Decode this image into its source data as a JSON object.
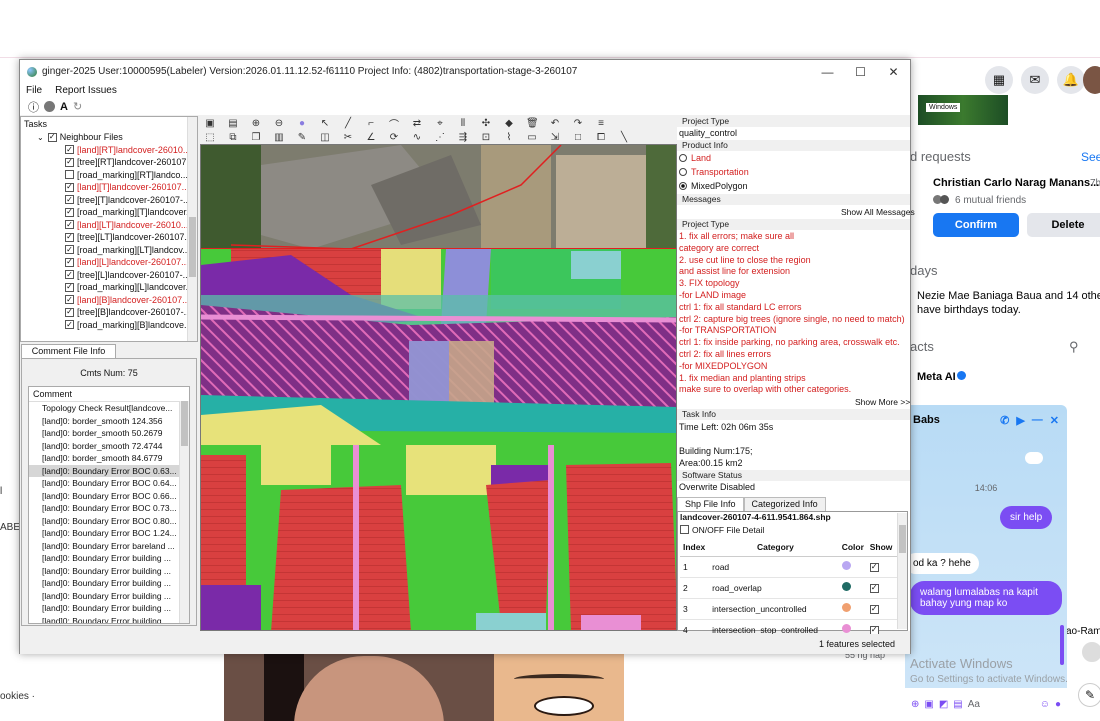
{
  "app": {
    "title": "ginger-2025   User:10000595(Labeler)   Version:2026.01.11.12.52-f61110   Project Info: (4802)transportation-stage-3-260107",
    "window_controls": [
      "—",
      "☐",
      "✕"
    ],
    "menu": [
      "File",
      "Report Issues"
    ]
  },
  "tasks": {
    "header": "Tasks",
    "group_label": "Neighbour Files",
    "items": [
      {
        "label": "[land][RT]landcover-26010...",
        "red": true,
        "checked": true
      },
      {
        "label": "[tree][RT]landcover-260107...",
        "red": false,
        "checked": true
      },
      {
        "label": "[road_marking][RT]landco...",
        "red": false,
        "checked": false
      },
      {
        "label": "[land][T]landcover-260107...",
        "red": true,
        "checked": true
      },
      {
        "label": "[tree][T]landcover-260107-...",
        "red": false,
        "checked": true
      },
      {
        "label": "[road_marking][T]landcover...",
        "red": false,
        "checked": true
      },
      {
        "label": "[land][LT]landcover-26010...",
        "red": true,
        "checked": true
      },
      {
        "label": "[tree][LT]landcover-260107...",
        "red": false,
        "checked": true
      },
      {
        "label": "[road_marking][LT]landcov...",
        "red": false,
        "checked": true
      },
      {
        "label": "[land][L]landcover-260107...",
        "red": true,
        "checked": true
      },
      {
        "label": "[tree][L]landcover-260107-...",
        "red": false,
        "checked": true
      },
      {
        "label": "[road_marking][L]landcover...",
        "red": false,
        "checked": true
      },
      {
        "label": "[land][B]landcover-260107...",
        "red": true,
        "checked": true
      },
      {
        "label": "[tree][B]landcover-260107-...",
        "red": false,
        "checked": true
      },
      {
        "label": "[road_marking][B]landcove...",
        "red": false,
        "checked": true
      }
    ]
  },
  "comments": {
    "tab_label": "Comment File Info",
    "count_label": "Cmts Num:  75",
    "column_header": "Comment",
    "rows": [
      "Topology Check Result[landcove...",
      "[land]0: border_smooth 124.356",
      "[land]0: border_smooth 50.2679",
      "[land]0: border_smooth 72.4744",
      "[land]0: border_smooth 84.6779",
      "[land]0: Boundary Error BOC 0.63...",
      "[land]0: Boundary Error BOC 0.64...",
      "[land]0: Boundary Error BOC 0.66...",
      "[land]0: Boundary Error BOC 0.73...",
      "[land]0: Boundary Error BOC 0.80...",
      "[land]0: Boundary Error BOC 1.24...",
      "[land]0: Boundary Error bareland ...",
      "[land]0: Boundary Error building ...",
      "[land]0: Boundary Error building ...",
      "[land]0: Boundary Error building ...",
      "[land]0: Boundary Error building ...",
      "[land]0: Boundary Error building ...",
      "[land]0: Boundary Error building ..."
    ],
    "selected_index": 5
  },
  "info": {
    "project_type_label": "Project Type",
    "project_type_value": "quality_control",
    "product_info_label": "Product Info",
    "products": [
      {
        "label": "Land",
        "red": true,
        "selected": false
      },
      {
        "label": "Transportation",
        "red": true,
        "selected": false
      },
      {
        "label": "MixedPolygon",
        "red": false,
        "selected": true
      }
    ],
    "messages_label": "Messages",
    "show_all_messages": "Show All Messages",
    "project_type_label_2": "Project Type",
    "instructions": [
      "1. fix all errors; make sure all",
      "category are correct",
      "2. use cut line to close the region",
      "and assist line for extension",
      "3. FIX topology",
      "-for LAND image",
      "ctrl 1: fix all standard LC errors",
      "ctrl 2: capture big trees (ignore single, no need to match)",
      "-for TRANSPORTATION",
      "ctrl 1: fix inside parking, no parking area, crosswalk etc.",
      "ctrl 2: fix all lines errors",
      "-for MIXEDPOLYGON",
      "1. fix median and planting strips",
      "make sure to overlap with other categories."
    ],
    "show_more": "Show More >>",
    "task_info_label": "Task Info",
    "time_left": "Time Left: 02h 06m 35s",
    "building_num": "Building Num:175;",
    "area": "Area:00.15 km2",
    "software_status_label": "Software Status",
    "overwrite": "Overwrite Disabled",
    "tabs": [
      "Shp File Info",
      "Categorized Info"
    ],
    "shp_file": "landcover-260107-4-611.9541.864.shp",
    "onoff_label": "ON/OFF File Detail",
    "table_headers": [
      "Index",
      "Category",
      "Color",
      "Show"
    ],
    "table_rows": [
      {
        "index": "1",
        "category": "road",
        "color": "#b9a7f2",
        "show": true
      },
      {
        "index": "2",
        "category": "road_overlap",
        "color": "#1f6b64",
        "show": true
      },
      {
        "index": "3",
        "category": "intersection_uncontrolled",
        "color": "#f0a070",
        "show": true
      },
      {
        "index": "4",
        "category": "intersection_stop_controlled",
        "color": "#e98fd4",
        "show": true
      }
    ]
  },
  "status": {
    "features_selected": "1 features selected"
  },
  "facebook": {
    "ad_text": "Windows",
    "friend_requests_title": "d requests",
    "see_all": "See",
    "requester_name": "Christian Carlo Narag Manans...",
    "requester_age": "7h",
    "mutual_friends": "6 mutual friends",
    "confirm": "Confirm",
    "delete": "Delete",
    "birthdays_title": "days",
    "birthday_text_1": "Nezie Mae Baniaga Baua and 14 others",
    "birthday_text_2": "have birthdays today.",
    "contacts_title": "acts",
    "meta_ai": "Meta AI",
    "chat_name": "Babs",
    "chat_time": "14:06",
    "chat_msg_1": "sir help",
    "chat_msg_2": "od ka ? hehe",
    "chat_msg_3": "walang lumalabas na kapit bahay yung map ko",
    "chat_input_placeholder": "Aa",
    "activate_title": "Activate Windows",
    "activate_sub": "Go to Settings to activate Windows.",
    "side_contact": "ao-Ram",
    "chat_small": "55 ng nap",
    "left_text_1": "l",
    "left_text_2": "ABE",
    "left_text_3": "ookies ·"
  }
}
